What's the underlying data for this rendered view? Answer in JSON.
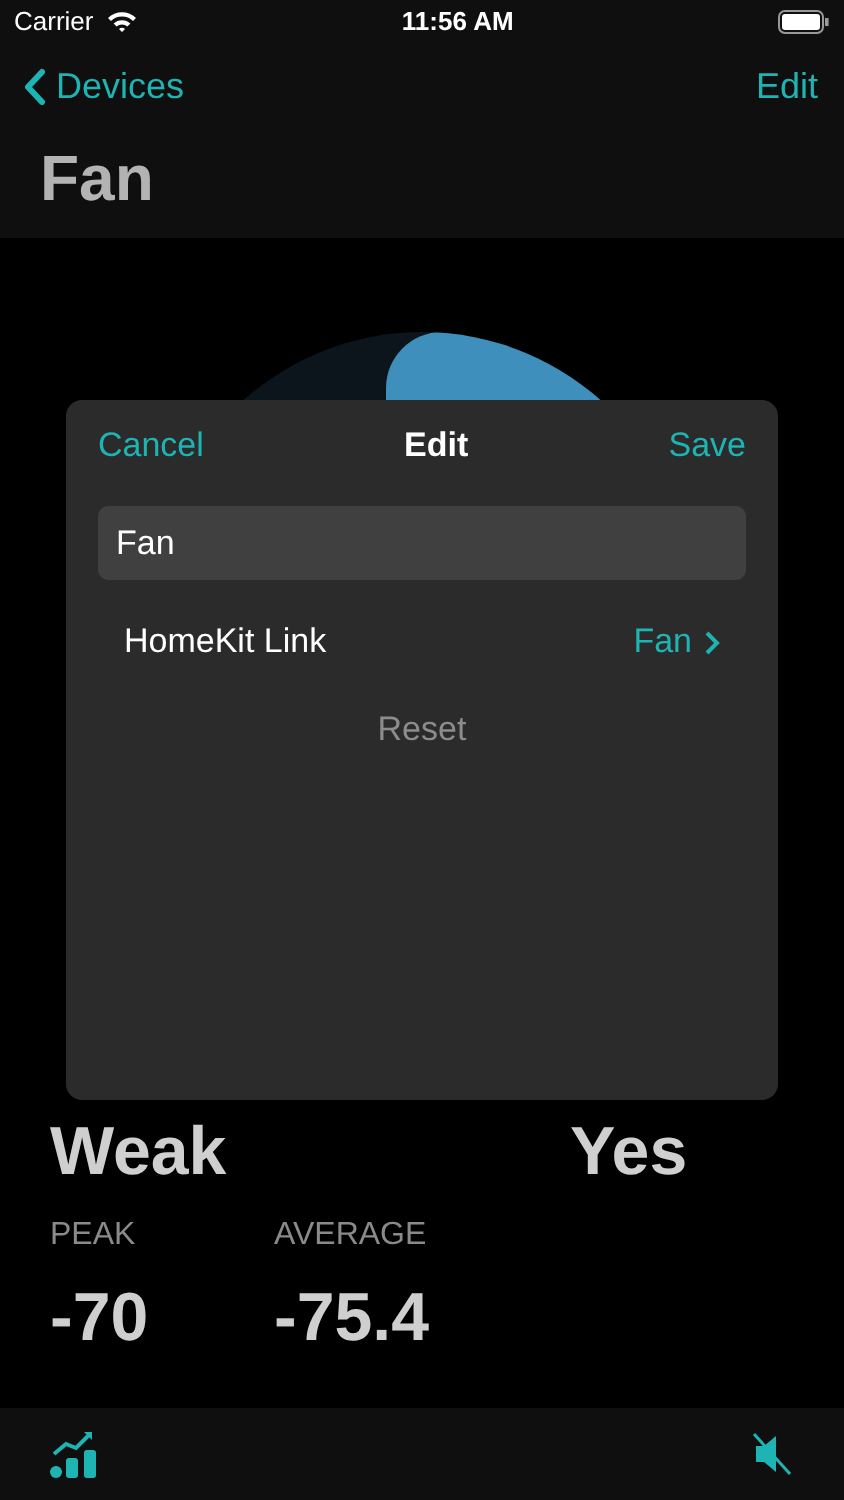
{
  "status_bar": {
    "carrier": "Carrier",
    "time": "11:56 AM"
  },
  "nav": {
    "back": "Devices",
    "action": "Edit",
    "title": "Fan"
  },
  "stats": [
    {
      "value": "Weak"
    },
    {
      "value": "Yes"
    }
  ],
  "readings": [
    {
      "label": "PEAK",
      "value": "-70"
    },
    {
      "label": "AVERAGE",
      "value": "-75.4"
    }
  ],
  "dialog": {
    "cancel": "Cancel",
    "title": "Edit",
    "save": "Save",
    "name_value": "Fan",
    "link_label": "HomeKit Link",
    "link_value": "Fan",
    "reset": "Reset"
  },
  "tab_bar": {
    "muted": true
  }
}
